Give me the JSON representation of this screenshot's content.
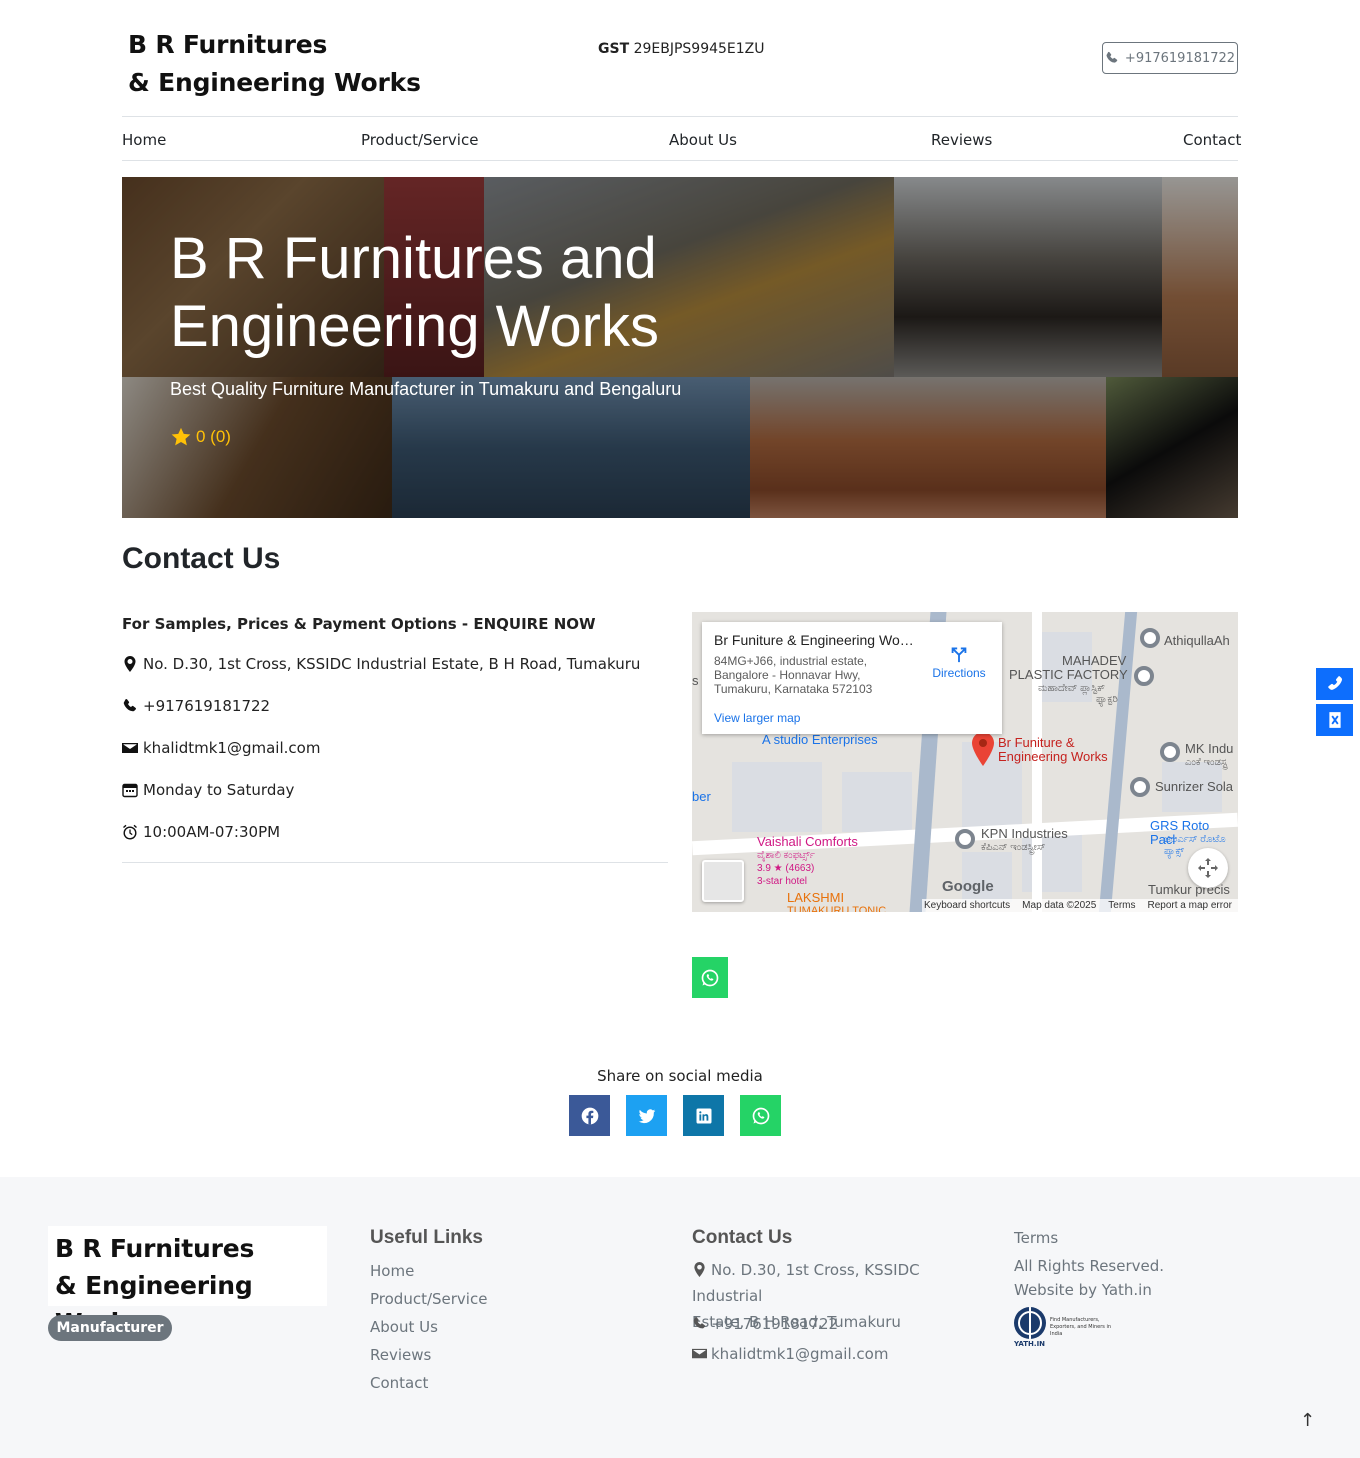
{
  "header": {
    "logo_line1": "B R Furnitures",
    "logo_line2": "& Engineering Works",
    "gst_label": "GST",
    "gst_value": "29EBJPS9945E1ZU",
    "phone": "+917619181722"
  },
  "nav": {
    "items": [
      "Home",
      "Product/Service",
      "About Us",
      "Reviews",
      "Contact"
    ]
  },
  "hero": {
    "title_line1": "B R Furnitures and",
    "title_line2": "Engineering Works",
    "subtitle": "Best Quality Furniture Manufacturer in Tumakuru and Bengaluru",
    "rating_text": "0 (0)",
    "star_color": "#ffc107"
  },
  "contact": {
    "title": "Contact Us",
    "enquire": "For Samples, Prices & Payment Options - ENQUIRE NOW",
    "address": "No. D.30, 1st Cross, KSSIDC Industrial Estate, B H Road, Tumakuru",
    "phone": "+917619181722",
    "email": "khalidtmk1@gmail.com",
    "days": "Monday to Saturday",
    "hours": "10:00AM-07:30PM"
  },
  "map": {
    "card_title": "Br Funiture & Engineering Wo…",
    "card_addr1": "84MG+J66, industrial estate,",
    "card_addr2": "Bangalore - Honnavar Hwy,",
    "card_addr3": "Tumakuru, Karnataka 572103",
    "directions": "Directions",
    "larger": "View larger map",
    "places": {
      "athiq": "AthiqullaAh",
      "mahadev1": "MAHADEV",
      "mahadev2": "PLASTIC FACTORY",
      "mahadev_kn": "ಮಹಾದೇವ್ ಪ್ಲಾಸ್ಟಿಕ್",
      "mahadev_kn2": "ಫ್ಯಾಕ್ಟರಿ",
      "astudio": "A studio Enterprises",
      "brf1": "Br Funiture &",
      "brf2": "Engineering Works",
      "mk": "MK Indu",
      "mk_kn": "ಎಂಕೆ ಇಂಡಸ್ಟ್ರ",
      "sunrizer": "Sunrizer Sola",
      "ber": "ber",
      "vaishali": "Vaishali Comforts",
      "vaishali_kn": "ವೈಶಾಲಿ ಕಂಫರ್ಟ್ಸ್",
      "vaishali_rating": "3.9 ★ (4663)",
      "vaishali_type": "3-star hotel",
      "kpn": "KPN Industries",
      "kpn_kn": "ಕೆಪಿಎನ್ ಇಂಡಸ್ಟ್ರೀಸ್",
      "grs": "GRS Roto Pacl",
      "grs_kn": "ಜಿಆರ್ಎಸ್ ರೊಟೊ",
      "grs_kn2": "ಪ್ಯಾಕ್ಸ್",
      "lakshmi1": "LAKSHMI",
      "lakshmi2": "TUMAKURU TONIC",
      "tumkur": "Tumkur precis",
      "s": "s"
    },
    "google": "Google",
    "footer_items": [
      "Keyboard shortcuts",
      "Map data ©2025",
      "Terms",
      "Report a map error"
    ]
  },
  "share": {
    "label": "Share on social media",
    "facebook_color": "#3b5998",
    "twitter_color": "#1da1f2",
    "linkedin_color": "#0e76a8",
    "whatsapp_color": "#25d366"
  },
  "footer": {
    "logo_line1": "B R Furnitures",
    "logo_line2": "& Engineering Works",
    "badge": "Manufacturer",
    "useful_title": "Useful Links",
    "links": [
      "Home",
      "Product/Service",
      "About Us",
      "Reviews",
      "Contact"
    ],
    "contact_title": "Contact Us",
    "addr_line1": "No. D.30, 1st Cross, KSSIDC Industrial",
    "addr_line2": "Estate, B H Road, Tumakuru",
    "phone": "+917619181722",
    "email": "khalidtmk1@gmail.com",
    "terms": "Terms",
    "rights": "All Rights Reserved.",
    "website_by": "Website by Yath.in",
    "yath_name": "YATH.IN",
    "yath_tag": "Find Manufacturers, Exporters, and Miners in India"
  },
  "icons": {
    "phone": "phone-icon",
    "location": "location-pin-icon",
    "email": "envelope-icon",
    "calendar": "calendar-icon",
    "clock": "alarm-clock-icon",
    "whatsapp": "whatsapp-icon",
    "scroll_top": "arrow-up-icon"
  },
  "scroll_top_glyph": "↑"
}
